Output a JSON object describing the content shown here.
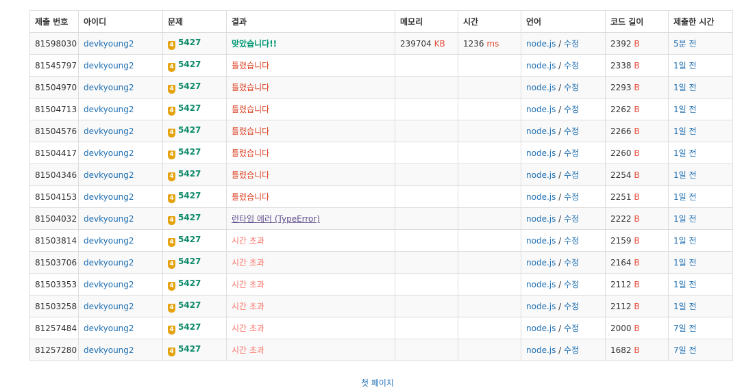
{
  "headers": [
    "제출 번호",
    "아이디",
    "문제",
    "결과",
    "메모리",
    "시간",
    "언어",
    "코드 길이",
    "제출한 시간"
  ],
  "rows": [
    {
      "id": "81598030",
      "user": "devkyoung2",
      "tier": "4",
      "problem": "5427",
      "result": "맞았습니다!!",
      "result_type": "ac",
      "memory": "239704",
      "memory_unit": "KB",
      "time": "1236",
      "time_unit": "ms",
      "lang": "node.js",
      "edit": "수정",
      "length": "2392",
      "length_unit": "B",
      "when": "5분 전"
    },
    {
      "id": "81545797",
      "user": "devkyoung2",
      "tier": "4",
      "problem": "5427",
      "result": "틀렸습니다",
      "result_type": "wa",
      "memory": "",
      "memory_unit": "",
      "time": "",
      "time_unit": "",
      "lang": "node.js",
      "edit": "수정",
      "length": "2338",
      "length_unit": "B",
      "when": "1일 전"
    },
    {
      "id": "81504970",
      "user": "devkyoung2",
      "tier": "4",
      "problem": "5427",
      "result": "틀렸습니다",
      "result_type": "wa",
      "memory": "",
      "memory_unit": "",
      "time": "",
      "time_unit": "",
      "lang": "node.js",
      "edit": "수정",
      "length": "2293",
      "length_unit": "B",
      "when": "1일 전"
    },
    {
      "id": "81504713",
      "user": "devkyoung2",
      "tier": "4",
      "problem": "5427",
      "result": "틀렸습니다",
      "result_type": "wa",
      "memory": "",
      "memory_unit": "",
      "time": "",
      "time_unit": "",
      "lang": "node.js",
      "edit": "수정",
      "length": "2262",
      "length_unit": "B",
      "when": "1일 전"
    },
    {
      "id": "81504576",
      "user": "devkyoung2",
      "tier": "4",
      "problem": "5427",
      "result": "틀렸습니다",
      "result_type": "wa",
      "memory": "",
      "memory_unit": "",
      "time": "",
      "time_unit": "",
      "lang": "node.js",
      "edit": "수정",
      "length": "2266",
      "length_unit": "B",
      "when": "1일 전"
    },
    {
      "id": "81504417",
      "user": "devkyoung2",
      "tier": "4",
      "problem": "5427",
      "result": "틀렸습니다",
      "result_type": "wa",
      "memory": "",
      "memory_unit": "",
      "time": "",
      "time_unit": "",
      "lang": "node.js",
      "edit": "수정",
      "length": "2260",
      "length_unit": "B",
      "when": "1일 전"
    },
    {
      "id": "81504346",
      "user": "devkyoung2",
      "tier": "4",
      "problem": "5427",
      "result": "틀렸습니다",
      "result_type": "wa",
      "memory": "",
      "memory_unit": "",
      "time": "",
      "time_unit": "",
      "lang": "node.js",
      "edit": "수정",
      "length": "2254",
      "length_unit": "B",
      "when": "1일 전"
    },
    {
      "id": "81504153",
      "user": "devkyoung2",
      "tier": "4",
      "problem": "5427",
      "result": "틀렸습니다",
      "result_type": "wa",
      "memory": "",
      "memory_unit": "",
      "time": "",
      "time_unit": "",
      "lang": "node.js",
      "edit": "수정",
      "length": "2251",
      "length_unit": "B",
      "when": "1일 전"
    },
    {
      "id": "81504032",
      "user": "devkyoung2",
      "tier": "4",
      "problem": "5427",
      "result": "런타임 에러 (TypeError)",
      "result_type": "rte",
      "memory": "",
      "memory_unit": "",
      "time": "",
      "time_unit": "",
      "lang": "node.js",
      "edit": "수정",
      "length": "2222",
      "length_unit": "B",
      "when": "1일 전"
    },
    {
      "id": "81503814",
      "user": "devkyoung2",
      "tier": "4",
      "problem": "5427",
      "result": "시간 초과",
      "result_type": "tle",
      "memory": "",
      "memory_unit": "",
      "time": "",
      "time_unit": "",
      "lang": "node.js",
      "edit": "수정",
      "length": "2159",
      "length_unit": "B",
      "when": "1일 전"
    },
    {
      "id": "81503706",
      "user": "devkyoung2",
      "tier": "4",
      "problem": "5427",
      "result": "시간 초과",
      "result_type": "tle",
      "memory": "",
      "memory_unit": "",
      "time": "",
      "time_unit": "",
      "lang": "node.js",
      "edit": "수정",
      "length": "2164",
      "length_unit": "B",
      "when": "1일 전"
    },
    {
      "id": "81503353",
      "user": "devkyoung2",
      "tier": "4",
      "problem": "5427",
      "result": "시간 초과",
      "result_type": "tle",
      "memory": "",
      "memory_unit": "",
      "time": "",
      "time_unit": "",
      "lang": "node.js",
      "edit": "수정",
      "length": "2112",
      "length_unit": "B",
      "when": "1일 전"
    },
    {
      "id": "81503258",
      "user": "devkyoung2",
      "tier": "4",
      "problem": "5427",
      "result": "시간 초과",
      "result_type": "tle",
      "memory": "",
      "memory_unit": "",
      "time": "",
      "time_unit": "",
      "lang": "node.js",
      "edit": "수정",
      "length": "2112",
      "length_unit": "B",
      "when": "1일 전"
    },
    {
      "id": "81257484",
      "user": "devkyoung2",
      "tier": "4",
      "problem": "5427",
      "result": "시간 초과",
      "result_type": "tle",
      "memory": "",
      "memory_unit": "",
      "time": "",
      "time_unit": "",
      "lang": "node.js",
      "edit": "수정",
      "length": "2000",
      "length_unit": "B",
      "when": "7일 전"
    },
    {
      "id": "81257280",
      "user": "devkyoung2",
      "tier": "4",
      "problem": "5427",
      "result": "시간 초과",
      "result_type": "tle",
      "memory": "",
      "memory_unit": "",
      "time": "",
      "time_unit": "",
      "lang": "node.js",
      "edit": "수정",
      "length": "1682",
      "length_unit": "B",
      "when": "7일 전"
    }
  ],
  "pager": {
    "first_page": "첫 페이지"
  },
  "colors": {
    "link": "#1f6fb2",
    "accepted": "#009874",
    "wrong": "#dd4124",
    "runtime_error": "#5f4b8b",
    "time_limit": "#fa7268",
    "unit": "#e74c3c",
    "tier_badge": "#e4a30e"
  },
  "icons": {
    "tier_badge": "gold-tier-shield-icon"
  }
}
